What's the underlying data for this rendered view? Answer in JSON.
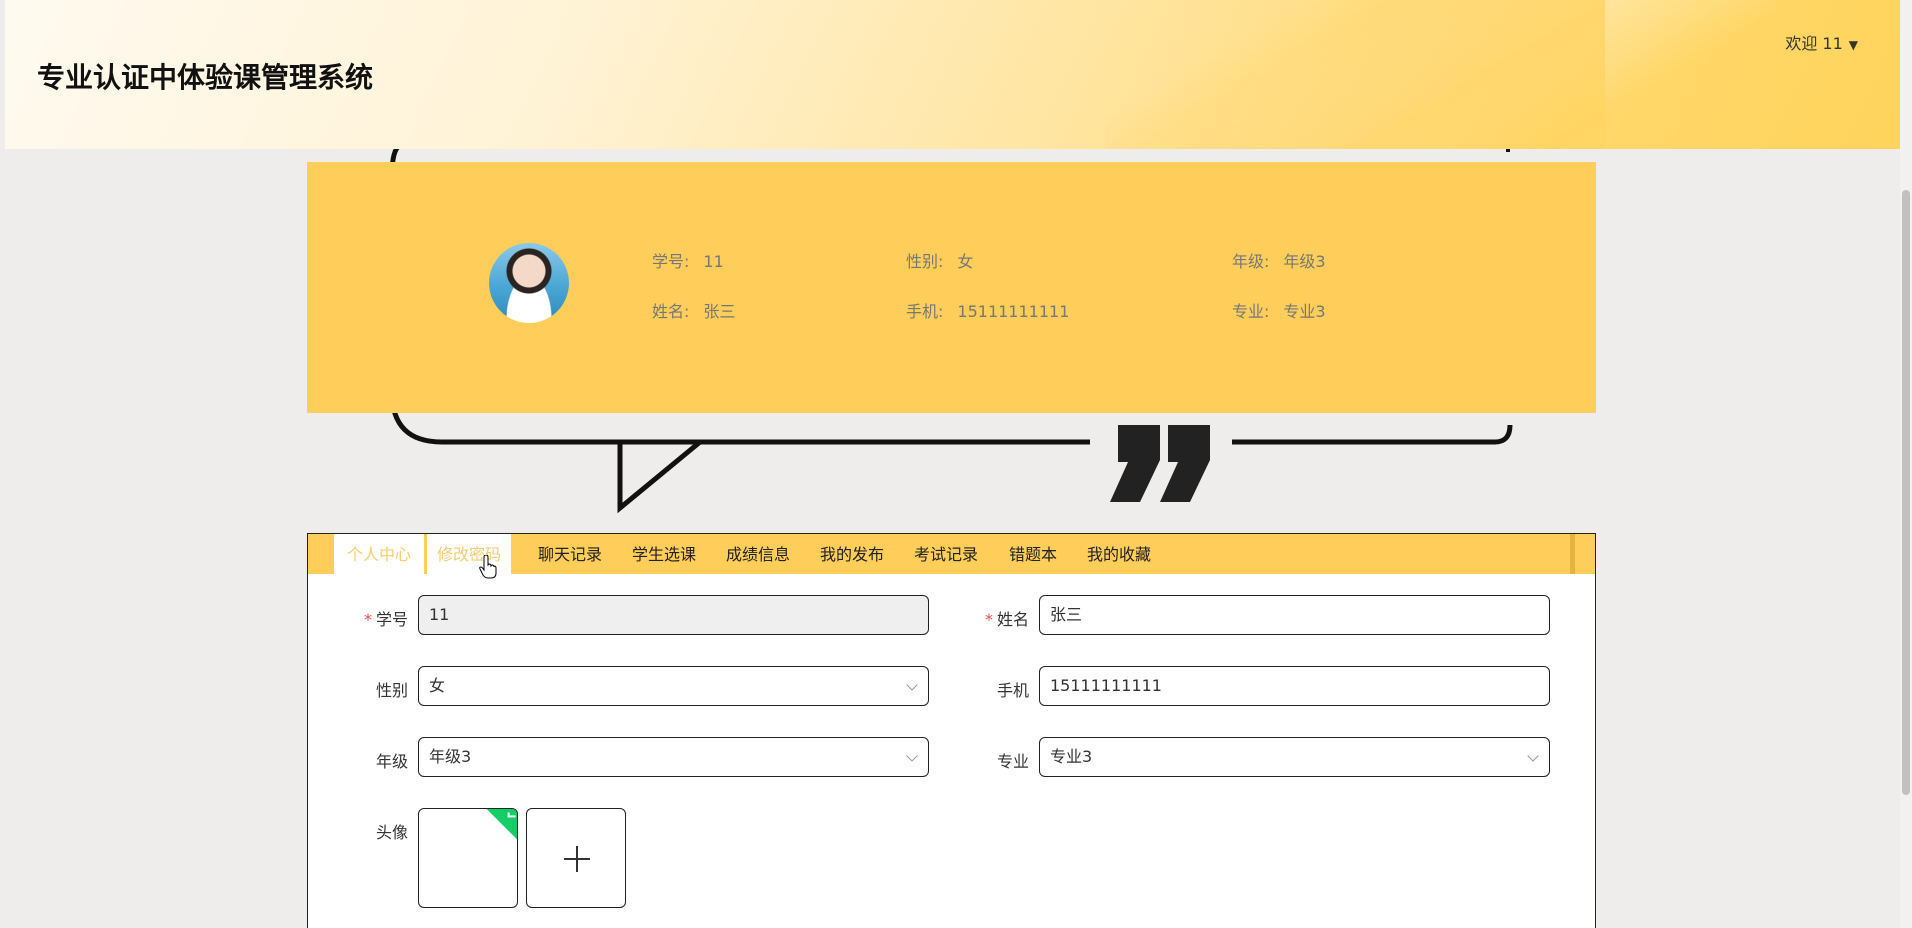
{
  "header": {
    "site_title": "专业认证中体验课管理系统",
    "welcome": "欢迎 11"
  },
  "profile": {
    "student_no_label": "学号:",
    "student_no": "11",
    "name_label": "姓名:",
    "name": "张三",
    "gender_label": "性别:",
    "gender": "女",
    "phone_label": "手机:",
    "phone": "15111111111",
    "grade_label": "年级:",
    "grade": "年级3",
    "major_label": "专业:",
    "major": "专业3"
  },
  "tabs": [
    {
      "label": "个人中心"
    },
    {
      "label": "修改密码"
    },
    {
      "label": "聊天记录"
    },
    {
      "label": "学生选课"
    },
    {
      "label": "成绩信息"
    },
    {
      "label": "我的发布"
    },
    {
      "label": "考试记录"
    },
    {
      "label": "错题本"
    },
    {
      "label": "我的收藏"
    }
  ],
  "form": {
    "student_no_label": "学号",
    "student_no_value": "11",
    "name_label": "姓名",
    "name_value": "张三",
    "gender_label": "性别",
    "gender_value": "女",
    "phone_label": "手机",
    "phone_value": "15111111111",
    "grade_label": "年级",
    "grade_value": "年级3",
    "major_label": "专业",
    "major_value": "专业3",
    "avatar_label": "头像",
    "required_mark": "*"
  },
  "icons": {
    "caret": "caret-down-icon",
    "plus": "plus-icon",
    "success": "check-badge-icon"
  },
  "colors": {
    "accent": "#fecd5a",
    "active_tab_text": "#f4cd70",
    "required": "#e54b4b",
    "success": "#13ce66"
  }
}
